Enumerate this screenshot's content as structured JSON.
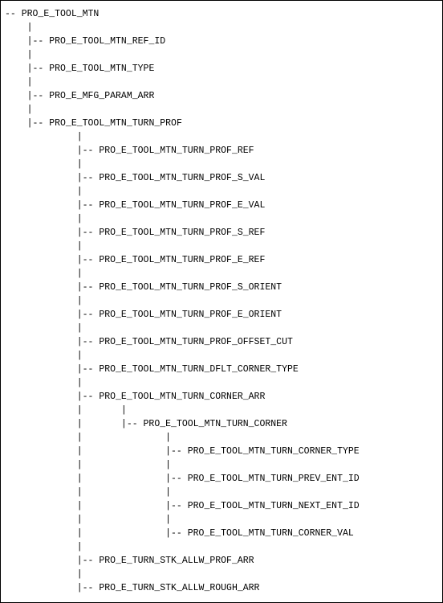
{
  "tree": {
    "root": "PRO_E_TOOL_MTN",
    "level1": [
      "PRO_E_TOOL_MTN_REF_ID",
      "PRO_E_TOOL_MTN_TYPE",
      "PRO_E_MFG_PARAM_ARR",
      "PRO_E_TOOL_MTN_TURN_PROF"
    ],
    "level2": [
      "PRO_E_TOOL_MTN_TURN_PROF_REF",
      "PRO_E_TOOL_MTN_TURN_PROF_S_VAL",
      "PRO_E_TOOL_MTN_TURN_PROF_E_VAL",
      "PRO_E_TOOL_MTN_TURN_PROF_S_REF",
      "PRO_E_TOOL_MTN_TURN_PROF_E_REF",
      "PRO_E_TOOL_MTN_TURN_PROF_S_ORIENT",
      "PRO_E_TOOL_MTN_TURN_PROF_E_ORIENT",
      "PRO_E_TOOL_MTN_TURN_PROF_OFFSET_CUT",
      "PRO_E_TOOL_MTN_TURN_DFLT_CORNER_TYPE",
      "PRO_E_TOOL_MTN_TURN_CORNER_ARR"
    ],
    "level3": [
      "PRO_E_TOOL_MTN_TURN_CORNER"
    ],
    "level4": [
      "PRO_E_TOOL_MTN_TURN_CORNER_TYPE",
      "PRO_E_TOOL_MTN_TURN_PREV_ENT_ID",
      "PRO_E_TOOL_MTN_TURN_NEXT_ENT_ID",
      "PRO_E_TOOL_MTN_TURN_CORNER_VAL"
    ],
    "level2_tail": [
      "PRO_E_TURN_STK_ALLW_PROF_ARR",
      "PRO_E_TURN_STK_ALLW_ROUGH_ARR"
    ]
  }
}
